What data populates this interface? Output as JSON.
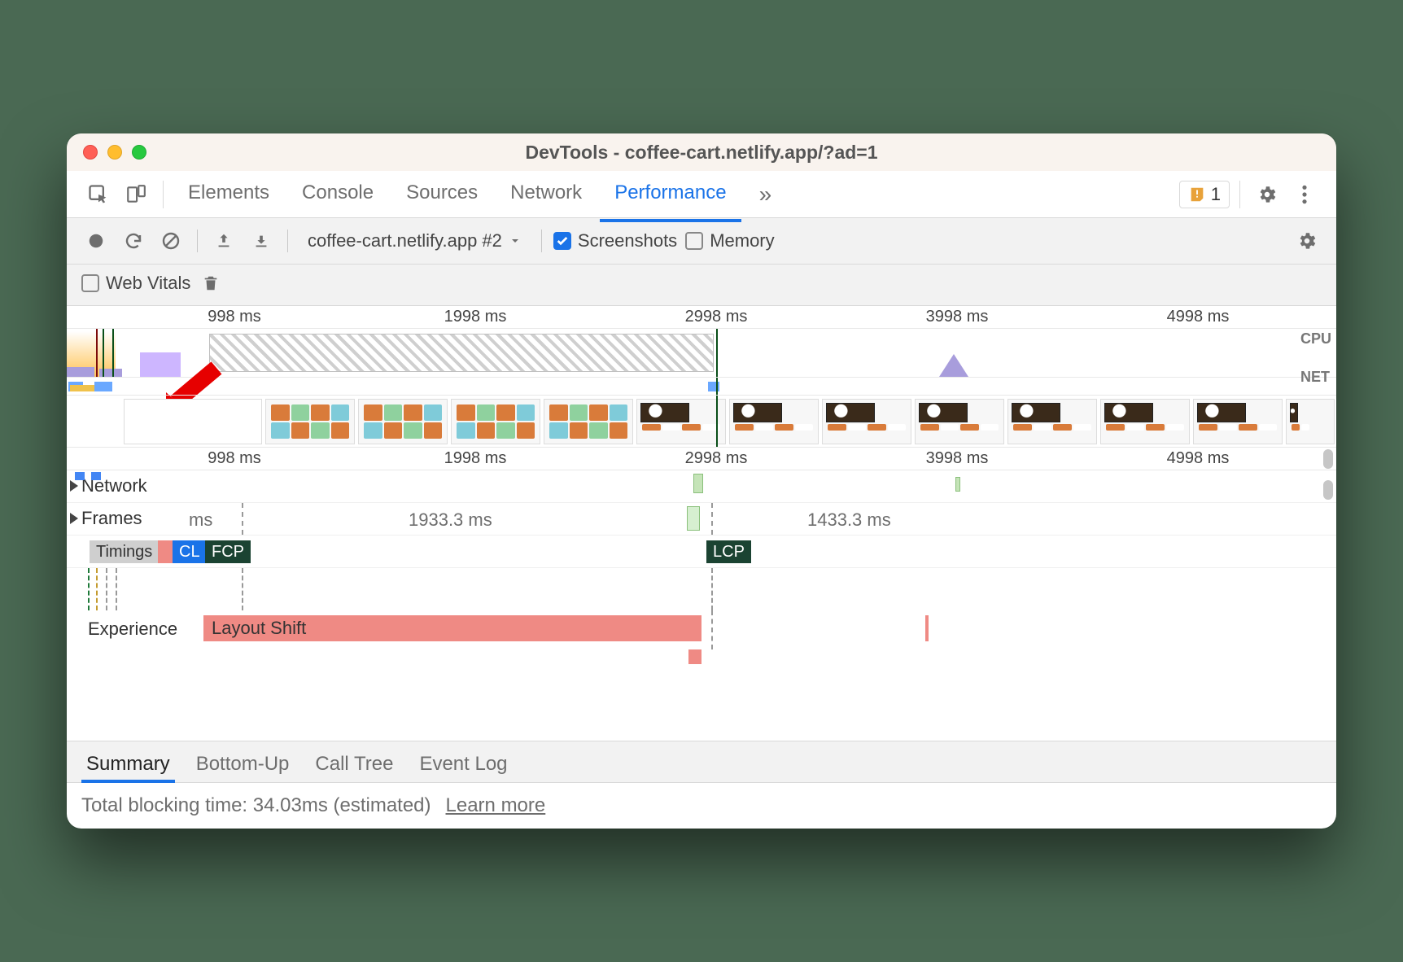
{
  "window": {
    "title": "DevTools - coffee-cart.netlify.app/?ad=1"
  },
  "panelTabs": {
    "items": [
      "Elements",
      "Console",
      "Sources",
      "Network",
      "Performance"
    ],
    "activeIndex": 4,
    "moreGlyph": "»",
    "issuesCount": "1"
  },
  "perfToolbar": {
    "recordingName": "coffee-cart.netlify.app #2",
    "screenshotsLabel": "Screenshots",
    "screenshotsChecked": true,
    "memoryLabel": "Memory",
    "memoryChecked": false,
    "webVitalsLabel": "Web Vitals",
    "webVitalsChecked": false
  },
  "timeline": {
    "rulerTicks": [
      "998 ms",
      "1998 ms",
      "2998 ms",
      "3998 ms",
      "4998 ms"
    ],
    "sideLabels": {
      "cpu": "CPU",
      "net": "NET"
    },
    "tracks": {
      "network": "Network",
      "frames": "Frames",
      "framesTimes": {
        "left": "ms",
        "a": "1933.3 ms",
        "b": "1433.3 ms"
      },
      "timingsLabel": "Timings",
      "timingTags": {
        "cls": "CL",
        "fcp": "FCP",
        "lcp": "LCP"
      },
      "experienceLabel": "Experience",
      "layoutShiftLabel": "Layout Shift"
    }
  },
  "summaryTabs": {
    "items": [
      "Summary",
      "Bottom-Up",
      "Call Tree",
      "Event Log"
    ],
    "activeIndex": 0
  },
  "status": {
    "tbtText": "Total blocking time: 34.03ms (estimated)",
    "learnMore": "Learn more"
  },
  "chart_data": {
    "type": "timeline",
    "x_unit": "ms",
    "x_range": [
      0,
      5200
    ],
    "ruler_ticks_ms": [
      998,
      1998,
      2998,
      3998,
      4998
    ],
    "selection_ms": [
      60,
      2998
    ],
    "cpu_activity_regions_ms": [
      [
        0,
        260
      ],
      [
        260,
        700,
        "hatched-long-task"
      ],
      [
        3900,
        3960
      ]
    ],
    "web_vitals_markers": [
      {
        "name": "CLS",
        "at_ms": 220
      },
      {
        "name": "FCP",
        "at_ms": 270
      },
      {
        "name": "LCP",
        "at_ms": 2998
      }
    ],
    "frames_durations_ms": [
      1933.3,
      1433.3
    ],
    "experience_layout_shift_ms": [
      270,
      2998
    ],
    "experience_slivers_ms": [
      4180
    ],
    "total_blocking_time_ms": 34.03
  }
}
